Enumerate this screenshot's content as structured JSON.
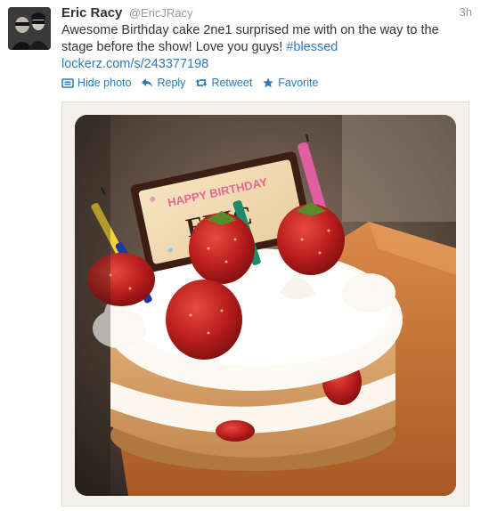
{
  "tweet": {
    "author": {
      "full_name": "Eric Racy",
      "username": "@EricJRacy"
    },
    "timestamp": "3h",
    "text_main": "Awesome Birthday cake 2ne1 surprised me with on the way to the stage before the show! Love you guys! ",
    "hashtag": "#blessed",
    "link": "lockerz.com/s/243377198",
    "actions": {
      "hide_photo": "Hide photo",
      "reply": "Reply",
      "retweet": "Retweet",
      "favorite": "Favorite"
    },
    "photo": {
      "plaque_line1": "HAPPY BIRTHDAY",
      "plaque_line2": "ERIC"
    }
  },
  "colors": {
    "link": "#2b7bb9",
    "text": "#333333",
    "muted": "#999999"
  }
}
